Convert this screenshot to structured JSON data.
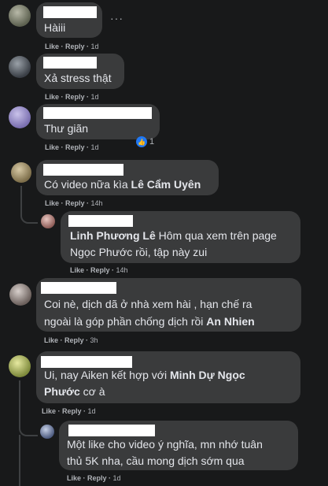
{
  "ui": {
    "like": "Like",
    "reply": "Reply",
    "sep": " · ",
    "more": "···"
  },
  "comments": [
    {
      "text": "Hàiii",
      "time": "1d"
    },
    {
      "text": "Xả stress thật",
      "time": "1d"
    },
    {
      "text": "Thư giãn",
      "time": "1d",
      "reaction_count": "1"
    },
    {
      "text_before": "Có video nữa kìa ",
      "mention": "Lê Cẩm Uyên",
      "time": "14h"
    },
    {
      "mention": "Linh Phương Lê",
      "line1_after": " Hôm qua xem trên page",
      "line2": "Ngọc Phước rồi, tập này zui",
      "time": "14h"
    },
    {
      "line1": "Coi nè, dịch dã ở nhà xem hài , hạn chế ra",
      "line2_before": "ngoài là góp phần chống dịch rồi ",
      "mention": "An Nhien",
      "time": "3h"
    },
    {
      "line1_before": "Ui, nay Aiken kết hợp với ",
      "mention": "Minh Dự Ngọc",
      "mention2": "Phước",
      "line2_after": " cơ à",
      "time": "1d"
    },
    {
      "line1": "Một like cho video ý nghĩa, mn nhớ tuân",
      "line2": "thủ 5K nha, cầu mong dịch sớm qua",
      "time": "1d"
    }
  ]
}
